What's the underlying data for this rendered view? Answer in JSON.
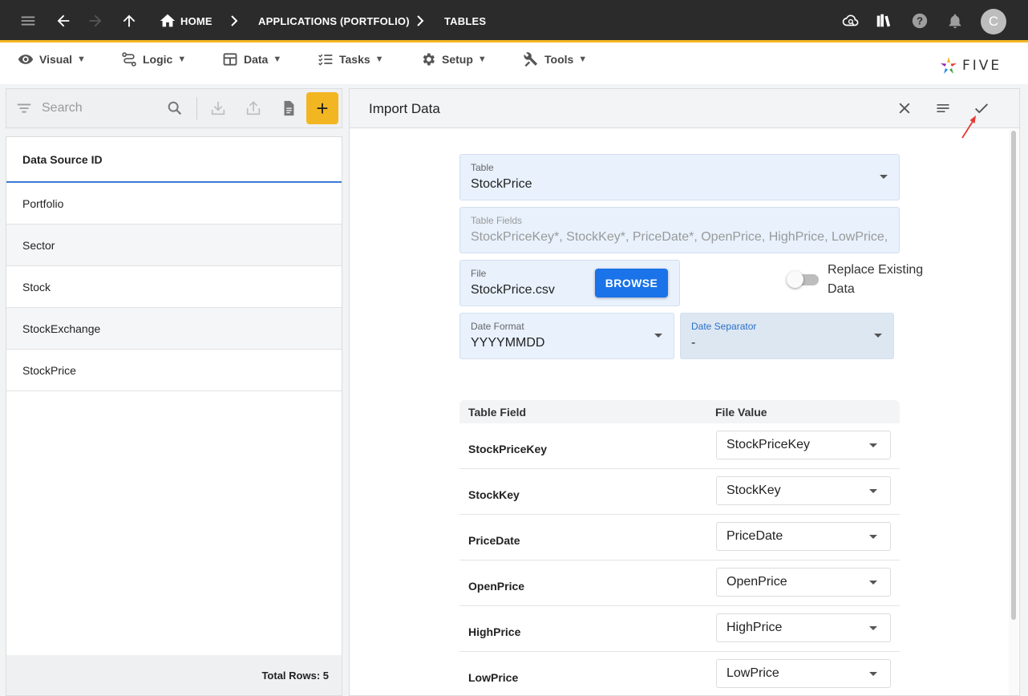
{
  "topbar": {
    "breadcrumbs": [
      "HOME",
      "APPLICATIONS (PORTFOLIO)",
      "TABLES"
    ],
    "avatar_initial": "C",
    "icons": [
      "hamburger-icon",
      "back-arrow-icon",
      "forward-arrow-icon",
      "up-arrow-icon",
      "home-icon",
      "cloud-sync-icon",
      "library-icon",
      "help-icon",
      "bell-icon"
    ]
  },
  "menubar": {
    "items": [
      {
        "label": "Visual",
        "icon": "eye-icon"
      },
      {
        "label": "Logic",
        "icon": "logic-icon"
      },
      {
        "label": "Data",
        "icon": "table-icon"
      },
      {
        "label": "Tasks",
        "icon": "checklist-icon"
      },
      {
        "label": "Setup",
        "icon": "gear-icon"
      },
      {
        "label": "Tools",
        "icon": "tools-icon"
      }
    ],
    "caret": "▼",
    "logo_text": "FIVE"
  },
  "left": {
    "search_placeholder": "Search",
    "add_symbol": "+",
    "column_header": "Data Source ID",
    "rows": [
      "Portfolio",
      "Sector",
      "Stock",
      "StockExchange",
      "StockPrice"
    ],
    "footer": "Total Rows: 5"
  },
  "form": {
    "title": "Import Data",
    "table": {
      "label": "Table",
      "value": "StockPrice"
    },
    "table_fields": {
      "label": "Table Fields",
      "value": "StockPriceKey*, StockKey*, PriceDate*, OpenPrice, HighPrice, LowPrice, ClosePrice"
    },
    "file": {
      "label": "File",
      "value": "StockPrice.csv",
      "browse_label": "BROWSE"
    },
    "replace_existing": {
      "label_line1": "Replace Existing",
      "label_line2": "Data",
      "on": false
    },
    "date_format": {
      "label": "Date Format",
      "value": "YYYYMMDD"
    },
    "date_separator": {
      "label": "Date Separator",
      "value": "-"
    },
    "mapping": {
      "col_table_field": "Table Field",
      "col_file_value": "File Value",
      "rows": [
        {
          "field": "StockPriceKey",
          "value": "StockPriceKey"
        },
        {
          "field": "StockKey",
          "value": "StockKey"
        },
        {
          "field": "PriceDate",
          "value": "PriceDate"
        },
        {
          "field": "OpenPrice",
          "value": "OpenPrice"
        },
        {
          "field": "HighPrice",
          "value": "HighPrice"
        },
        {
          "field": "LowPrice",
          "value": "LowPrice"
        }
      ]
    }
  },
  "colors": {
    "topbar": "#2b2b2b",
    "accent": "#f3b623",
    "primary": "#1a73e8",
    "field_bg": "#e8f1fc",
    "annotation_arrow": "#e53935"
  }
}
